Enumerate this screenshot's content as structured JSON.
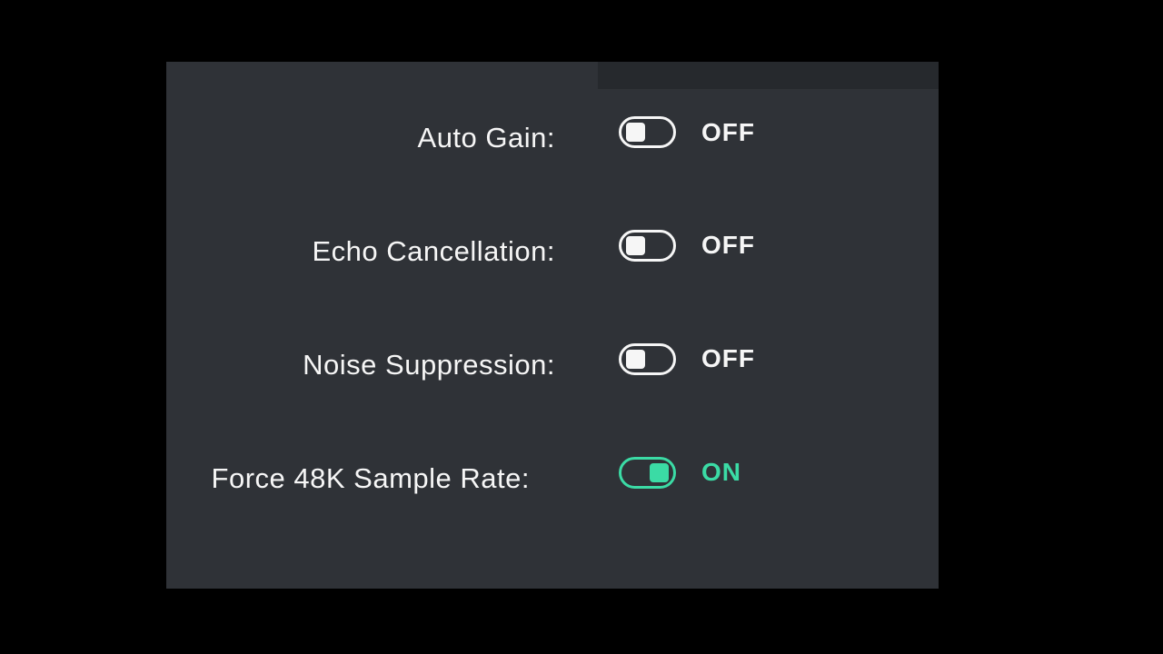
{
  "settings": [
    {
      "label": "Auto Gain:",
      "state": "OFF",
      "on": false
    },
    {
      "label": "Echo Cancellation:",
      "state": "OFF",
      "on": false
    },
    {
      "label": "Noise Suppression:",
      "state": "OFF",
      "on": false
    },
    {
      "label": "Force 48K Sample Rate:",
      "state": "ON",
      "on": true
    }
  ],
  "colors": {
    "panel": "#2f3237",
    "accent": "#3bdba5",
    "text": "#f6f6f6"
  }
}
